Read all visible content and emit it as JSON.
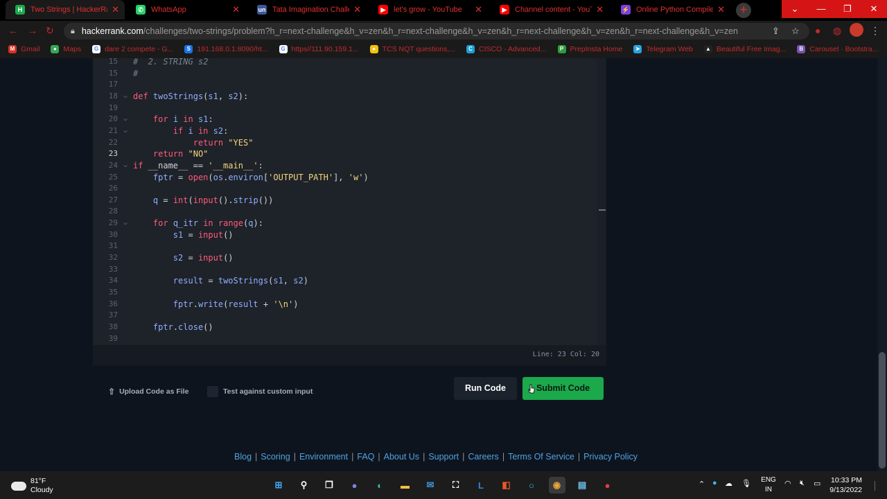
{
  "browser": {
    "tabs": [
      {
        "title": "Two Strings | HackerRank",
        "favicon": "hackerrank-favicon",
        "active": true
      },
      {
        "title": "WhatsApp",
        "favicon": "whatsapp-favicon",
        "active": false
      },
      {
        "title": "Tata Imagination Challenge",
        "favicon": "tata-favicon",
        "active": false
      },
      {
        "title": "let's grow - YouTube",
        "favicon": "youtube-favicon",
        "active": false
      },
      {
        "title": "Channel content - YouTube",
        "favicon": "youtube-favicon",
        "active": false
      },
      {
        "title": "Online Python Compiler",
        "favicon": "compiler-favicon",
        "active": false
      }
    ],
    "new_tab": "+",
    "window_controls": [
      "⌄",
      "—",
      "❐",
      "✕"
    ],
    "url_host": "hackerrank.com",
    "url_path": "/challenges/two-strings/problem?h_r=next-challenge&h_v=zen&h_r=next-challenge&h_v=zen&h_r=next-challenge&h_v=zen&h_r=next-challenge&h_v=zen",
    "bookmarks": [
      {
        "label": "Gmail",
        "icon": "gmail-icon",
        "color": "#d93025",
        "glyph": "M"
      },
      {
        "label": "Maps",
        "icon": "maps-icon",
        "color": "#34a853",
        "glyph": "●"
      },
      {
        "label": "dare 2 compete - G...",
        "icon": "google-icon",
        "color": "#ffffff",
        "glyph": "G"
      },
      {
        "label": "191.168.0.1:8090/ht...",
        "icon": "sophos-icon",
        "color": "#1a73e8",
        "glyph": "S"
      },
      {
        "label": "https//111.90.159.1...",
        "icon": "google-icon",
        "color": "#ffffff",
        "glyph": "G"
      },
      {
        "label": "TCS NQT questions,...",
        "icon": "tcs-icon",
        "color": "#f4c20d",
        "glyph": "●"
      },
      {
        "label": "CISCO - Advanced...",
        "icon": "cisco-icon",
        "color": "#1ba0d7",
        "glyph": "C"
      },
      {
        "label": "PrepInsta Home",
        "icon": "prepinsta-icon",
        "color": "#2e9b3e",
        "glyph": "P"
      },
      {
        "label": "Telegram Web",
        "icon": "telegram-icon",
        "color": "#2aa3df",
        "glyph": "➤"
      },
      {
        "label": "Beautiful Free Imag...",
        "icon": "unsplash-icon",
        "color": "#222222",
        "glyph": "▲"
      },
      {
        "label": "Carousel · Bootstra...",
        "icon": "bootstrap-icon",
        "color": "#7952b3",
        "glyph": "B"
      }
    ]
  },
  "editor": {
    "lines": [
      {
        "num": "15",
        "fold": "",
        "text": "#  2. STRING s2",
        "type": "comment"
      },
      {
        "num": "15",
        "fold": "",
        "text": "#",
        "type": "comment"
      },
      {
        "num": "17",
        "fold": "",
        "text": "",
        "type": "plain"
      },
      {
        "num": "18",
        "fold": "⌵",
        "html": "<span class='k'>def</span> <span class='f'>twoStrings</span>(<span class='f'>s1</span>, <span class='f'>s2</span>):"
      },
      {
        "num": "19",
        "fold": "",
        "text": "",
        "type": "plain"
      },
      {
        "num": "20",
        "fold": "⌵",
        "html": "    <span class='k'>for</span> <span class='f'>i</span> <span class='k'>in</span> <span class='f'>s1</span>:"
      },
      {
        "num": "21",
        "fold": "⌵",
        "html": "        <span class='k'>if</span> <span class='f'>i</span> <span class='k'>in</span> <span class='f'>s2</span>:"
      },
      {
        "num": "22",
        "fold": "",
        "html": "            <span class='k'>return</span> <span class='s'>\"YES\"</span>"
      },
      {
        "num": "23",
        "fold": "",
        "current": true,
        "html": "    <span class='k'>return</span> <span class='s'>\"NO\"</span>"
      },
      {
        "num": "24",
        "fold": "⌵",
        "html": "<span class='k'>if</span> __name__ == <span class='s'>'__main__'</span>:"
      },
      {
        "num": "25",
        "fold": "",
        "html": "    <span class='f'>fptr</span> = <span class='k'>open</span>(<span class='f'>os</span>.<span class='f'>environ</span>[<span class='s'>'OUTPUT_PATH'</span>], <span class='s'>'w'</span>)"
      },
      {
        "num": "26",
        "fold": "",
        "text": "",
        "type": "plain"
      },
      {
        "num": "27",
        "fold": "",
        "html": "    <span class='f'>q</span> = <span class='k'>int</span>(<span class='k'>input</span>().<span class='f'>strip</span>())"
      },
      {
        "num": "28",
        "fold": "",
        "text": "",
        "type": "plain"
      },
      {
        "num": "29",
        "fold": "⌵",
        "html": "    <span class='k'>for</span> <span class='f'>q_itr</span> <span class='k'>in</span> <span class='k'>range</span>(<span class='f'>q</span>):"
      },
      {
        "num": "30",
        "fold": "",
        "html": "        <span class='f'>s1</span> = <span class='k'>input</span>()"
      },
      {
        "num": "31",
        "fold": "",
        "text": "",
        "type": "plain"
      },
      {
        "num": "32",
        "fold": "",
        "html": "        <span class='f'>s2</span> = <span class='k'>input</span>()"
      },
      {
        "num": "33",
        "fold": "",
        "text": "",
        "type": "plain"
      },
      {
        "num": "34",
        "fold": "",
        "html": "        <span class='f'>result</span> = <span class='f'>twoStrings</span>(<span class='f'>s1</span>, <span class='f'>s2</span>)"
      },
      {
        "num": "35",
        "fold": "",
        "text": "",
        "type": "plain"
      },
      {
        "num": "36",
        "fold": "",
        "html": "        <span class='f'>fptr</span>.<span class='f'>write</span>(<span class='f'>result</span> + <span class='s'>'\\n'</span>)"
      },
      {
        "num": "37",
        "fold": "",
        "text": "",
        "type": "plain"
      },
      {
        "num": "38",
        "fold": "",
        "html": "    <span class='f'>fptr</span>.<span class='f'>close</span>()"
      },
      {
        "num": "39",
        "fold": "",
        "text": "",
        "type": "plain"
      }
    ],
    "cursor_position": "Line: 23 Col: 20"
  },
  "actions": {
    "upload_label": "Upload Code as File",
    "custom_input_label": "Test against custom input",
    "run_label": "Run Code",
    "submit_label": "Submit Code"
  },
  "footer": {
    "links": [
      "Blog",
      "Scoring",
      "Environment",
      "FAQ",
      "About Us",
      "Support",
      "Careers",
      "Terms Of Service",
      "Privacy Policy"
    ]
  },
  "taskbar": {
    "temperature": "81°F",
    "condition": "Cloudy",
    "language_line1": "ENG",
    "language_line2": "IN",
    "time": "10:33 PM",
    "date": "9/13/2022",
    "apps": [
      {
        "name": "start-icon",
        "glyph": "⊞",
        "color": "#3fa9f5"
      },
      {
        "name": "search-icon",
        "glyph": "⚲",
        "color": "#ffffff"
      },
      {
        "name": "task-view-icon",
        "glyph": "❐",
        "color": "#ffffff"
      },
      {
        "name": "chat-icon",
        "glyph": "●",
        "color": "#7b83eb"
      },
      {
        "name": "edge-icon",
        "glyph": "◐",
        "color": "#2ec4b6"
      },
      {
        "name": "file-explorer-icon",
        "glyph": "▬",
        "color": "#f6c343"
      },
      {
        "name": "mail-icon",
        "glyph": "✉",
        "color": "#3a96dd"
      },
      {
        "name": "store-icon",
        "glyph": "⛶",
        "color": "#ffffff"
      },
      {
        "name": "app-l-icon",
        "glyph": "L",
        "color": "#2b88d8"
      },
      {
        "name": "office-icon",
        "glyph": "◧",
        "color": "#e8572a"
      },
      {
        "name": "cortana-icon",
        "glyph": "○",
        "color": "#3ab8f0"
      },
      {
        "name": "chrome-icon",
        "glyph": "◉",
        "color": "#e8a53a"
      },
      {
        "name": "notepad-icon",
        "glyph": "▤",
        "color": "#6fc3f0"
      },
      {
        "name": "recorder-icon",
        "glyph": "●",
        "color": "#e04040"
      }
    ]
  }
}
